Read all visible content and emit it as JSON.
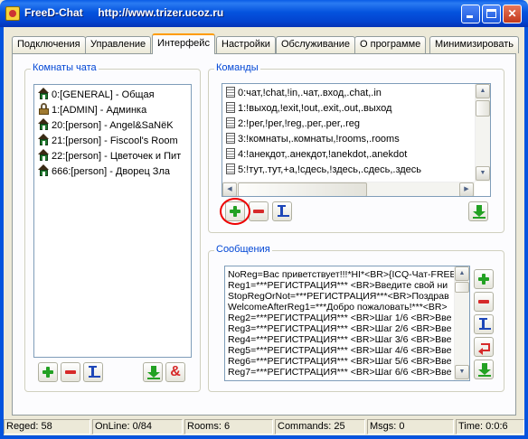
{
  "window": {
    "title": "FreeD-Chat     http://www.trizer.ucoz.ru",
    "minimize_label": "_",
    "maximize_label": "□",
    "close_label": "✕"
  },
  "tabs": [
    {
      "label": "Подключения",
      "active": false
    },
    {
      "label": "Управление",
      "active": false
    },
    {
      "label": "Интерфейс",
      "active": true
    },
    {
      "label": "Настройки",
      "active": false
    },
    {
      "label": "Обслуживание",
      "active": false
    },
    {
      "label": "О программе",
      "active": false
    },
    {
      "label": "Минимизировать",
      "active": false
    }
  ],
  "rooms_group": {
    "title": "Комнаты чата",
    "rooms": [
      {
        "label": "0:[GENERAL] - Общая",
        "icon": "room-icon"
      },
      {
        "label": "1:[ADMIN] - Админка",
        "icon": "lock-icon"
      },
      {
        "label": "20:[person] - Angel&SaNёK",
        "icon": "room-icon"
      },
      {
        "label": "21:[person] - Fiscool's Room",
        "icon": "room-icon"
      },
      {
        "label": "22:[person] - Цветочек и Пит",
        "icon": "room-icon"
      },
      {
        "label": "666:[person] - Дворец Зла",
        "icon": "room-icon"
      }
    ],
    "buttons": [
      "add-icon",
      "remove-icon",
      "edit-icon",
      "download-icon",
      "ampersand-icon"
    ],
    "amp_label": "&"
  },
  "commands_group": {
    "title": "Команды",
    "commands": [
      "0:чат,!chat,!in,.чат,.вход,.chat,.in",
      "1:!выход,!exit,!out,.exit,.out,.выход",
      "2:!рег,!per,!reg,.рег,.per,.reg",
      "3:!комнаты,.комнаты,!rooms,.rooms",
      "4:!анекдот,.анекдот,!anekdot,.anekdot",
      "5:!тут,.тут,+а,!сдесь,!здесь,.сдесь,.здесь"
    ],
    "buttons": [
      "add-icon",
      "remove-icon",
      "edit-icon",
      "download-icon"
    ]
  },
  "messages_group": {
    "title": "Сообщения",
    "messages": [
      "NoReg=Вас приветствует!!!*HI*<BR>{ICQ-Чат-FREE",
      "Reg1=***РЕГИСТРАЦИЯ*** <BR>Введите свой ни",
      "StopRegOrNot=***РЕГИСТРАЦИЯ***<BR>Поздрав",
      "WelcomeAfterReg1=***Добро пожаловать!***<BR>",
      "Reg2=***РЕГИСТРАЦИЯ*** <BR>Шаг 1/6 <BR>Вве",
      "Reg3=***РЕГИСТРАЦИЯ*** <BR>Шаг 2/6 <BR>Вве",
      "Reg4=***РЕГИСТРАЦИЯ*** <BR>Шаг 3/6 <BR>Вве",
      "Reg5=***РЕГИСТРАЦИЯ*** <BR>Шаг 4/6 <BR>Вве",
      "Reg6=***РЕГИСТРАЦИЯ*** <BR>Шаг 5/6 <BR>Вве",
      "Reg7=***РЕГИСТРАЦИЯ*** <BR>Шаг 6/6 <BR>Вве"
    ],
    "buttons": [
      "add-icon",
      "remove-icon",
      "edit-icon",
      "restore-icon",
      "download-icon"
    ]
  },
  "statusbar": {
    "reged": "Reged: 58",
    "online": "OnLine: 0/84",
    "rooms": "Rooms: 6",
    "commands": "Commands: 25",
    "msgs": "Msgs: 0",
    "time": "Time: 0:0:6"
  },
  "colors": {
    "titlebar": "#0453de",
    "group_title": "#0046d5",
    "active_tab_accent": "#ff9c00",
    "highlight_ring": "#e00000"
  }
}
